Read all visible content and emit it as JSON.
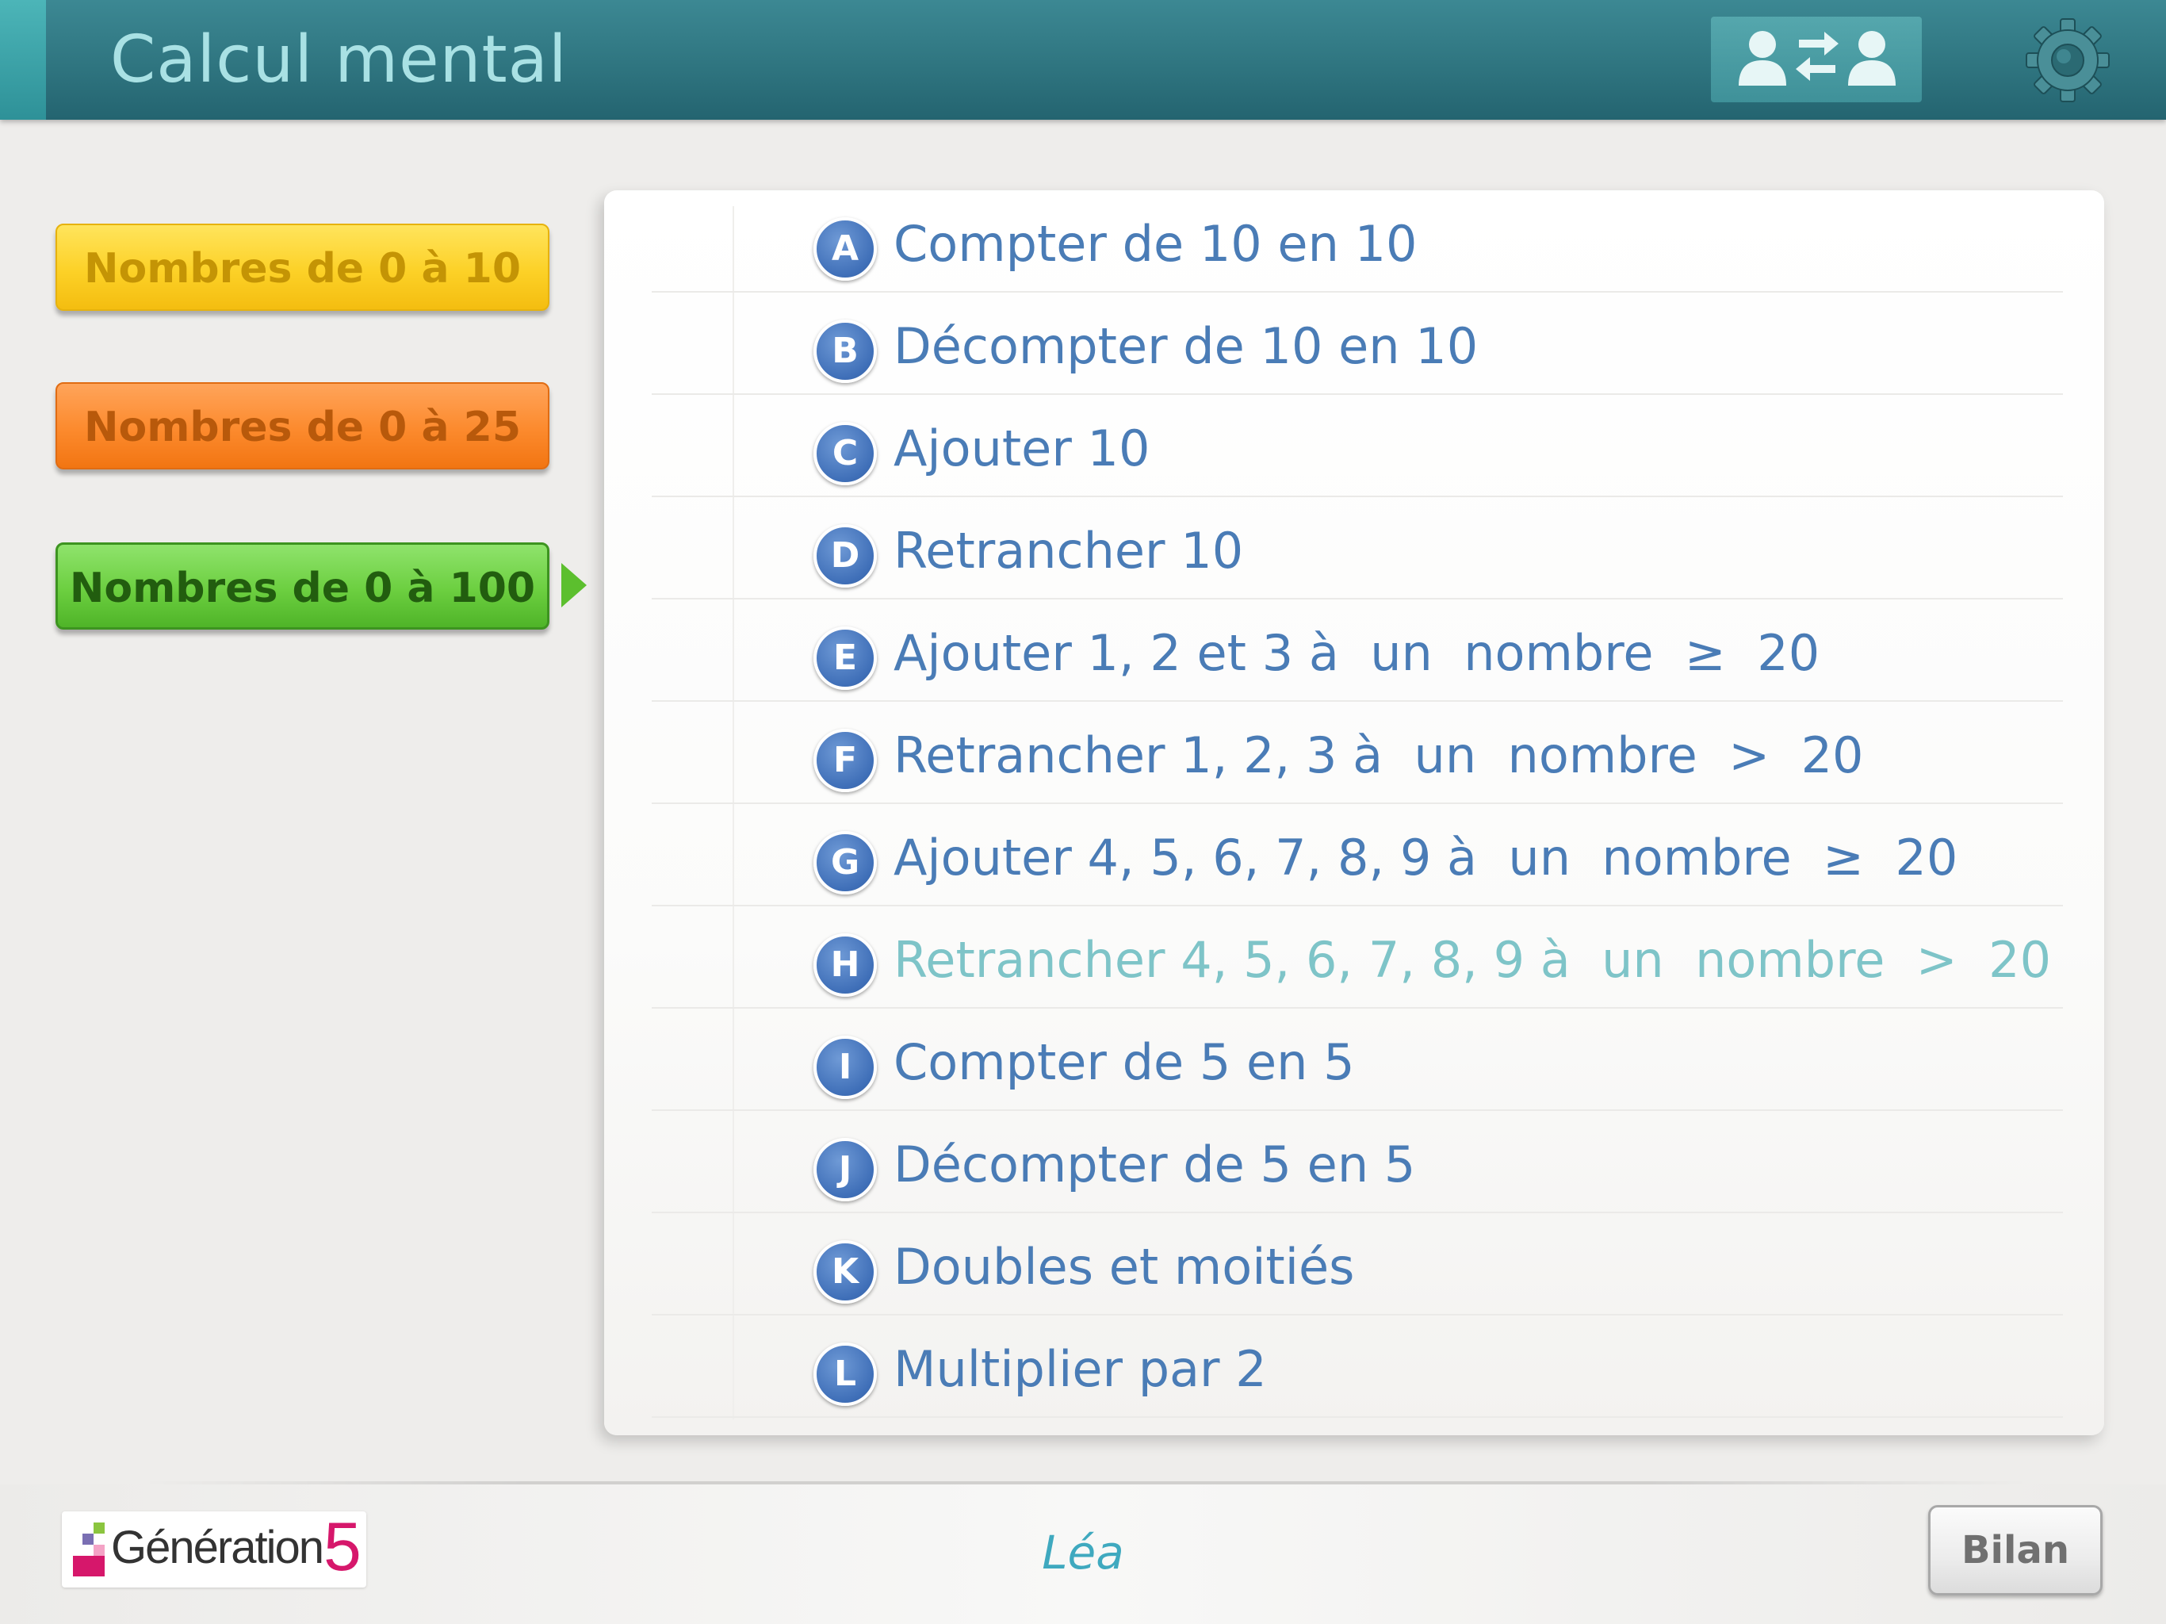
{
  "header": {
    "title": "Calcul mental",
    "switch_user_icon": "switch-user-icon",
    "settings_icon": "gear-icon"
  },
  "categories": [
    {
      "label": "Nombres de 0 à 10",
      "color": "#fcd127"
    },
    {
      "label": "Nombres de 0 à 25",
      "color": "#fc8a2d"
    },
    {
      "label": "Nombres de 0 à 100",
      "color": "#6ccf40",
      "selected": true
    }
  ],
  "exercises": [
    {
      "letter": "A",
      "label": "Compter de 10 en 10"
    },
    {
      "letter": "B",
      "label": "Décompter de 10 en 10"
    },
    {
      "letter": "C",
      "label": "Ajouter 10"
    },
    {
      "letter": "D",
      "label": "Retrancher 10"
    },
    {
      "letter": "E",
      "label": "Ajouter 1, 2 et 3 à  un  nombre  ≥  20"
    },
    {
      "letter": "F",
      "label": "Retrancher 1, 2, 3 à  un  nombre  >  20"
    },
    {
      "letter": "G",
      "label": "Ajouter 4, 5, 6, 7, 8, 9 à  un  nombre  ≥  20"
    },
    {
      "letter": "H",
      "label": "Retrancher 4, 5, 6, 7, 8, 9 à  un  nombre  >  20",
      "done": true
    },
    {
      "letter": "I",
      "label": "Compter de 5 en 5"
    },
    {
      "letter": "J",
      "label": "Décompter de 5 en 5"
    },
    {
      "letter": "K",
      "label": "Doubles et moitiés"
    },
    {
      "letter": "L",
      "label": "Multiplier par 2"
    }
  ],
  "footer": {
    "logo_text": "Génération",
    "logo_number": "5",
    "student_name": "Léa",
    "bilan_label": "Bilan"
  },
  "colors": {
    "header": "#2f7580",
    "exercise_text": "#4a7cb6",
    "exercise_done_text": "#7ec4c8",
    "badge": "#3f6fb8",
    "student_name": "#3fa9bf"
  }
}
